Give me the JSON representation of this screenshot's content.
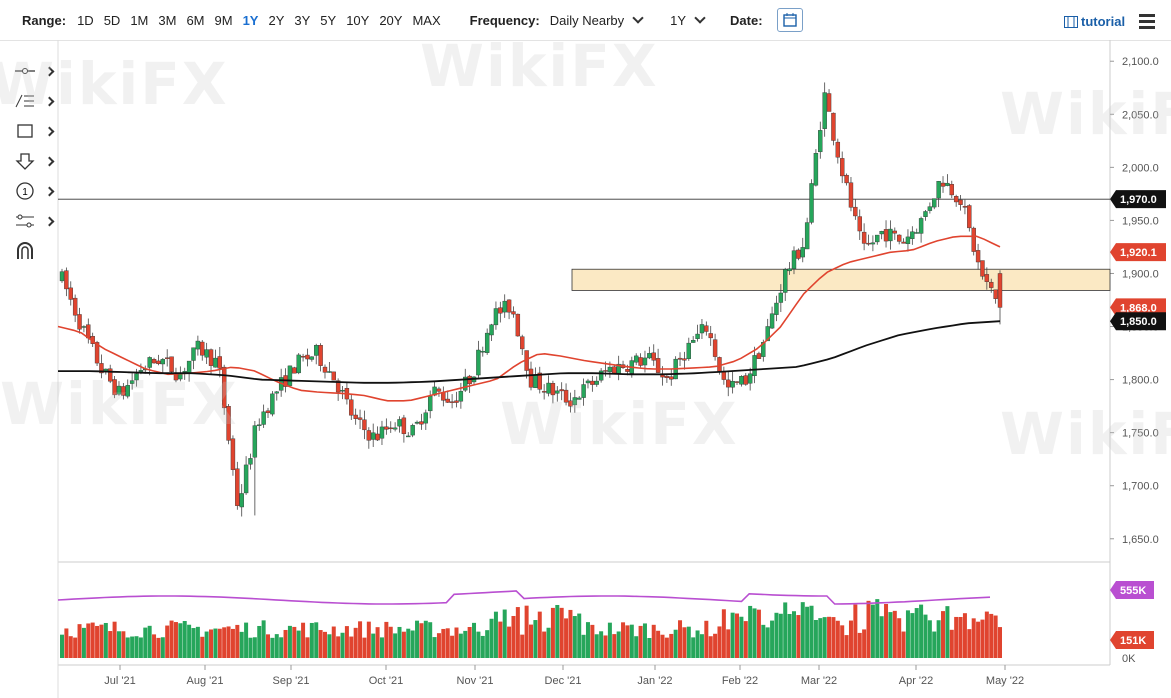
{
  "toolbar": {
    "range_label": "Range:",
    "ranges": [
      "1D",
      "5D",
      "1M",
      "3M",
      "6M",
      "9M",
      "1Y",
      "2Y",
      "3Y",
      "5Y",
      "10Y",
      "20Y",
      "MAX"
    ],
    "active_range": "1Y",
    "frequency_label": "Frequency:",
    "frequency_value": "Daily Nearby",
    "period_value": "1Y",
    "date_label": "Date:",
    "tutorial_label": "tutorial"
  },
  "watermark": "WikiFX",
  "colors": {
    "up": "#26a65b",
    "down": "#e0442f",
    "ma50": "#e0442f",
    "ma200": "#111111",
    "osc": "#b94fd1",
    "zone_fill": "#fbe9c4"
  },
  "chart_data": {
    "type": "candlestick",
    "y_ticks": [
      "2,100.0",
      "2,050.0",
      "2,000.0",
      "1,950.0",
      "1,900.0",
      "1,850.0",
      "1,800.0",
      "1,750.0",
      "1,700.0",
      "1,650.0"
    ],
    "ylim": [
      1630,
      2120
    ],
    "x_ticks": [
      "Jul '21",
      "Aug '21",
      "Sep '21",
      "Oct '21",
      "Nov '21",
      "Dec '21",
      "Jan '22",
      "Feb '22",
      "Mar '22",
      "Apr '22",
      "May '22"
    ],
    "price_labels": [
      {
        "text": "1,970.0",
        "value": 1970.0,
        "style": "dark"
      },
      {
        "text": "1,920.1",
        "value": 1920.1,
        "style": "red"
      },
      {
        "text": "1,868.0",
        "value": 1868.0,
        "style": "red"
      },
      {
        "text": "1,850.0",
        "value": 1855.0,
        "style": "dark"
      }
    ],
    "horizontal_line": 1970.0,
    "resistance_zone": [
      1884,
      1904
    ],
    "monthly_path": [
      1895,
      1850,
      1810,
      1785,
      1810,
      1820,
      1805,
      1830,
      1815,
      1680,
      1760,
      1790,
      1815,
      1825,
      1800,
      1760,
      1745,
      1760,
      1750,
      1790,
      1780,
      1805,
      1860,
      1870,
      1800,
      1790,
      1780,
      1795,
      1810,
      1815,
      1820,
      1800,
      1830,
      1850,
      1790,
      1800,
      1840,
      1900,
      1930,
      2070,
      1990,
      1920,
      1940,
      1930,
      1950,
      1990,
      1970,
      1900,
      1868
    ],
    "ma50_path": [
      1850,
      1845,
      1830,
      1820,
      1810,
      1805,
      1806,
      1808,
      1812,
      1808,
      1798,
      1790,
      1788,
      1787,
      1785,
      1780,
      1780,
      1785,
      1790,
      1795,
      1800,
      1815,
      1825,
      1822,
      1818,
      1815,
      1812,
      1810,
      1810,
      1811,
      1812,
      1818,
      1830,
      1850,
      1880,
      1900,
      1910,
      1915,
      1920,
      1922,
      1930,
      1935,
      1935,
      1925
    ],
    "ma200_path": [
      1808,
      1808,
      1807,
      1806,
      1806,
      1804,
      1800,
      1799,
      1798,
      1797,
      1797,
      1798,
      1800,
      1802,
      1804,
      1806,
      1806,
      1805,
      1805,
      1806,
      1808,
      1810,
      1812,
      1820,
      1832,
      1842,
      1848,
      1853,
      1855
    ],
    "volume_labels": [
      {
        "text": "555K"
      },
      {
        "text": "151K"
      }
    ],
    "volume_axis": [
      "0K"
    ]
  }
}
